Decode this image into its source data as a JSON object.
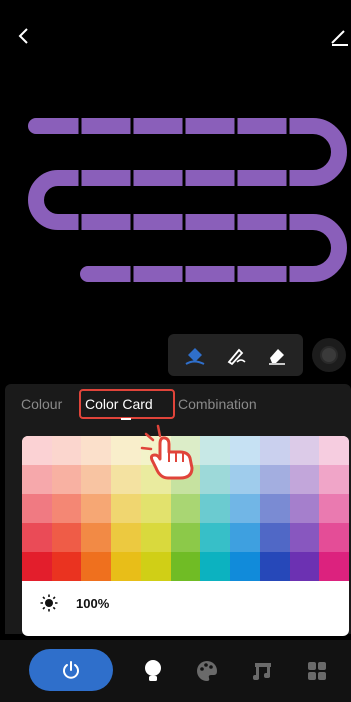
{
  "tabs": {
    "colour": "Colour",
    "color_card": "Color Card",
    "combination": "Combination"
  },
  "brightness": {
    "value": "100%"
  },
  "colors": {
    "strip": "#8a5fba",
    "accent_blue": "#2f6fcb",
    "highlight_red": "#e0443a"
  },
  "swatch_rows": [
    [
      "#fbd2d4",
      "#fbd6ce",
      "#fbe0cb",
      "#f9eecb",
      "#f3f3c9",
      "#dcedc8",
      "#c7e8e6",
      "#c6e1f3",
      "#cad0ee",
      "#dccbe8",
      "#f6cde0"
    ],
    [
      "#f6a8ab",
      "#f8b1a2",
      "#f8c4a2",
      "#f4e2a1",
      "#eaeb9f",
      "#c6e2a0",
      "#9dd9d9",
      "#9fccec",
      "#a3aee0",
      "#c2a6da",
      "#f0a5c8"
    ],
    [
      "#f07a82",
      "#f48774",
      "#f6a774",
      "#f0d670",
      "#e2e26d",
      "#a9d673",
      "#6bcbd0",
      "#71b6e6",
      "#7a8bd3",
      "#a57fcc",
      "#ea7ab0"
    ],
    [
      "#ea4b57",
      "#ef5c47",
      "#f28a45",
      "#ecc940",
      "#d9d93d",
      "#8cc949",
      "#37bfc8",
      "#3ea0e0",
      "#5068c6",
      "#8857bf",
      "#e44d97"
    ],
    [
      "#e31e2c",
      "#ea3320",
      "#ef701e",
      "#e8be18",
      "#d0cf16",
      "#70bc25",
      "#0cb2c0",
      "#118bda",
      "#2648b9",
      "#6c31b2",
      "#dc227e"
    ]
  ],
  "icons": {
    "back": "chevron-left-icon",
    "edit": "pencil-icon",
    "bucket": "paint-bucket-icon",
    "pen": "pen-icon",
    "eraser": "eraser-icon",
    "mic": "mic-icon",
    "sun": "sun-icon",
    "hand": "hand-pointer-icon",
    "power": "power-icon",
    "bulb": "bulb-icon",
    "palette": "palette-icon",
    "music": "music-icon",
    "grid": "grid-icon"
  }
}
